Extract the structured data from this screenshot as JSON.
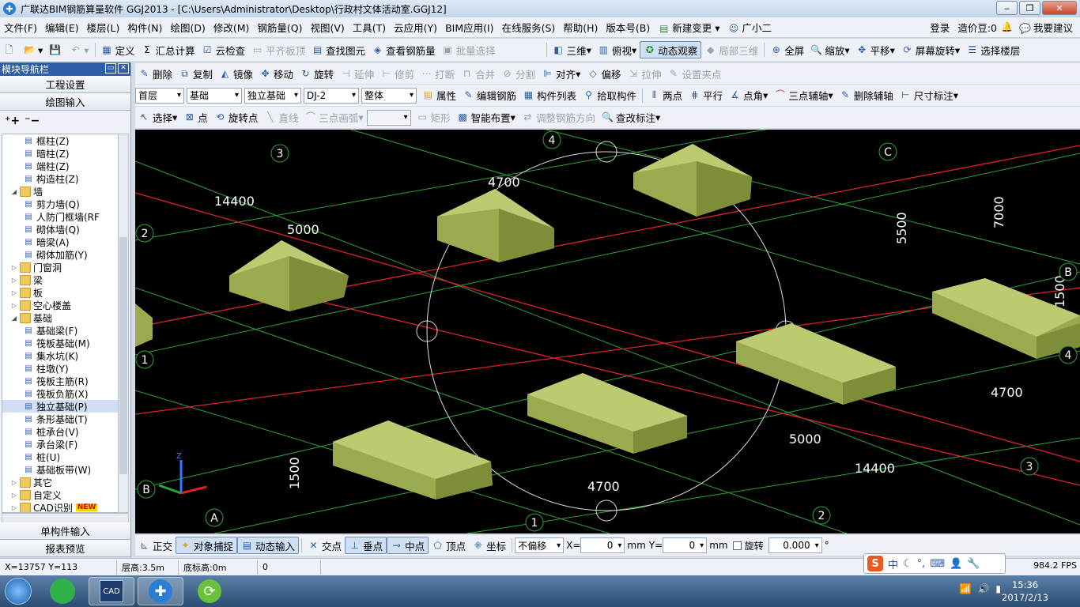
{
  "window": {
    "title": "广联达BIM钢筋算量软件 GGJ2013 - [C:\\Users\\Administrator\\Desktop\\行政村文体活动室.GGJ12]",
    "min": "‒",
    "max": "❐",
    "close": "✕"
  },
  "menu": {
    "items": [
      "文件(F)",
      "编辑(E)",
      "楼层(L)",
      "构件(N)",
      "绘图(D)",
      "修改(M)",
      "钢筋量(Q)",
      "视图(V)",
      "工具(T)",
      "云应用(Y)",
      "BIM应用(I)",
      "在线服务(S)",
      "帮助(H)",
      "版本号(B)",
      "新建变更",
      "广小二"
    ],
    "login": "登录",
    "coins": "造价豆:0",
    "suggest": "我要建议"
  },
  "toolbar1": {
    "items": [
      "定义",
      "汇总计算",
      "云检查",
      "平齐板顶",
      "查找图元",
      "查看钢筋量",
      "批量选择",
      "三维",
      "俯视",
      "动态观察",
      "局部三维",
      "全屏",
      "缩放",
      "平移",
      "屏幕旋转",
      "选择楼层"
    ]
  },
  "toolbar2": {
    "items": [
      "删除",
      "复制",
      "镜像",
      "移动",
      "旋转",
      "延伸",
      "修剪",
      "打断",
      "合并",
      "分割",
      "对齐",
      "偏移",
      "拉伸",
      "设置夹点"
    ]
  },
  "toolbar3": {
    "floor": "首层",
    "category": "基础",
    "type": "独立基础",
    "element": "DJ-2",
    "mode": "整体",
    "items": [
      "属性",
      "编辑钢筋",
      "构件列表",
      "拾取构件",
      "两点",
      "平行",
      "点角",
      "三点辅轴",
      "删除辅轴",
      "尺寸标注"
    ]
  },
  "toolbar4": {
    "items": [
      "选择",
      "点",
      "旋转点",
      "直线",
      "三点画弧",
      "矩形",
      "智能布置",
      "调整钢筋方向",
      "查改标注"
    ]
  },
  "sidebar": {
    "title": "模块导航栏",
    "top_buttons": [
      "工程设置",
      "绘图输入"
    ],
    "bottom_buttons": [
      "单构件输入",
      "报表预览"
    ],
    "tree": [
      {
        "label": "框柱(Z)",
        "level": 2,
        "kind": "leaf"
      },
      {
        "label": "暗柱(Z)",
        "level": 2,
        "kind": "leaf"
      },
      {
        "label": "端柱(Z)",
        "level": 2,
        "kind": "leaf"
      },
      {
        "label": "构造柱(Z)",
        "level": 2,
        "kind": "leaf"
      },
      {
        "label": "墙",
        "level": 1,
        "kind": "folder",
        "exp": "◢"
      },
      {
        "label": "剪力墙(Q)",
        "level": 2,
        "kind": "leaf"
      },
      {
        "label": "人防门框墙(RF",
        "level": 2,
        "kind": "leaf"
      },
      {
        "label": "砌体墙(Q)",
        "level": 2,
        "kind": "leaf"
      },
      {
        "label": "暗梁(A)",
        "level": 2,
        "kind": "leaf"
      },
      {
        "label": "砌体加筋(Y)",
        "level": 2,
        "kind": "leaf"
      },
      {
        "label": "门窗洞",
        "level": 1,
        "kind": "folder",
        "exp": "▷"
      },
      {
        "label": "梁",
        "level": 1,
        "kind": "folder",
        "exp": "▷"
      },
      {
        "label": "板",
        "level": 1,
        "kind": "folder",
        "exp": "▷"
      },
      {
        "label": "空心楼盖",
        "level": 1,
        "kind": "folder",
        "exp": "▷"
      },
      {
        "label": "基础",
        "level": 1,
        "kind": "folder",
        "exp": "◢"
      },
      {
        "label": "基础梁(F)",
        "level": 2,
        "kind": "leaf"
      },
      {
        "label": "筏板基础(M)",
        "level": 2,
        "kind": "leaf"
      },
      {
        "label": "集水坑(K)",
        "level": 2,
        "kind": "leaf"
      },
      {
        "label": "柱墩(Y)",
        "level": 2,
        "kind": "leaf"
      },
      {
        "label": "筏板主筋(R)",
        "level": 2,
        "kind": "leaf"
      },
      {
        "label": "筏板负筋(X)",
        "level": 2,
        "kind": "leaf"
      },
      {
        "label": "独立基础(P)",
        "level": 2,
        "kind": "leaf",
        "selected": true
      },
      {
        "label": "条形基础(T)",
        "level": 2,
        "kind": "leaf"
      },
      {
        "label": "桩承台(V)",
        "level": 2,
        "kind": "leaf"
      },
      {
        "label": "承台梁(F)",
        "level": 2,
        "kind": "leaf"
      },
      {
        "label": "桩(U)",
        "level": 2,
        "kind": "leaf"
      },
      {
        "label": "基础板带(W)",
        "level": 2,
        "kind": "leaf"
      },
      {
        "label": "其它",
        "level": 1,
        "kind": "folder",
        "exp": "▷"
      },
      {
        "label": "自定义",
        "level": 1,
        "kind": "folder",
        "exp": "▷"
      },
      {
        "label": "CAD识别",
        "level": 1,
        "kind": "folder",
        "exp": "▷",
        "badge": "NEW"
      }
    ]
  },
  "canvas": {
    "labels": [
      {
        "t": "14400"
      },
      {
        "t": "5000"
      },
      {
        "t": "4700"
      },
      {
        "t": "5500"
      },
      {
        "t": "7000"
      },
      {
        "t": "1500"
      },
      {
        "t": "4700"
      },
      {
        "t": "5000"
      },
      {
        "t": "14400"
      },
      {
        "t": "4700"
      },
      {
        "t": "1500"
      },
      {
        "t": "5500"
      }
    ],
    "axis_bubbles": [
      "3",
      "4",
      "C",
      "2",
      "1",
      "B",
      "4",
      "3",
      "2",
      "1",
      "A",
      "B"
    ]
  },
  "bottombar": {
    "items": [
      "正交",
      "对象捕捉",
      "动态输入",
      "交点",
      "垂点",
      "中点",
      "顶点",
      "坐标"
    ],
    "offset_mode": "不偏移",
    "x_label": "X=",
    "x_value": "0",
    "x_unit": "mm",
    "y_label": "Y=",
    "y_value": "0",
    "y_unit": "mm",
    "rotate_label": "旋转",
    "rotate_value": "0.000",
    "degree": "°"
  },
  "status": {
    "coords": "X=13757 Y=113",
    "floor_height": "层高:3.5m",
    "base_height": "底标高:0m",
    "value": "0",
    "fps": "984.2 FPS"
  },
  "taskbar": {
    "time": "15:36",
    "date": "2017/2/13",
    "cad_label": "CAD"
  },
  "colors": {
    "accent": "#2f5ea8",
    "footing": "#9aab4f",
    "grid_green": "#2fa43a",
    "axis_red": "#e0212b"
  }
}
